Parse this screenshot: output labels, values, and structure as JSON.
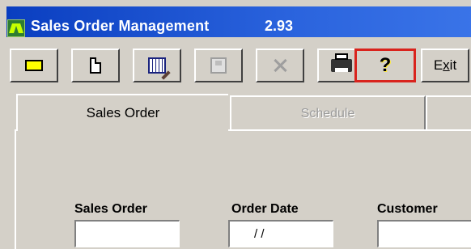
{
  "window": {
    "title": "Sales Order Management",
    "version": "2.93"
  },
  "toolbar": {
    "buttons": [
      {
        "name": "open-button",
        "icon": "folder-open-icon"
      },
      {
        "name": "new-button",
        "icon": "new-document-icon"
      },
      {
        "name": "edit-button",
        "icon": "calendar-edit-icon"
      },
      {
        "name": "save-button",
        "icon": "save-disk-icon"
      },
      {
        "name": "delete-button",
        "icon": "delete-x-icon"
      },
      {
        "name": "print-button",
        "icon": "printer-icon"
      },
      {
        "name": "help-button",
        "icon": "help-question-icon",
        "label": "?"
      },
      {
        "name": "exit-button",
        "label": "Exit"
      }
    ]
  },
  "tabs": [
    {
      "label": "Sales Order",
      "active": true
    },
    {
      "label": "Schedule",
      "active": false
    }
  ],
  "form": {
    "sales_order_label": "Sales Order",
    "sales_order_value": "",
    "order_date_label": "Order Date",
    "order_date_value": "/ /",
    "customer_label": "Customer",
    "customer_value": ""
  },
  "colors": {
    "titlebar": "#0a3ec0",
    "face": "#d4d0c8",
    "highlight": "#d9231d"
  }
}
